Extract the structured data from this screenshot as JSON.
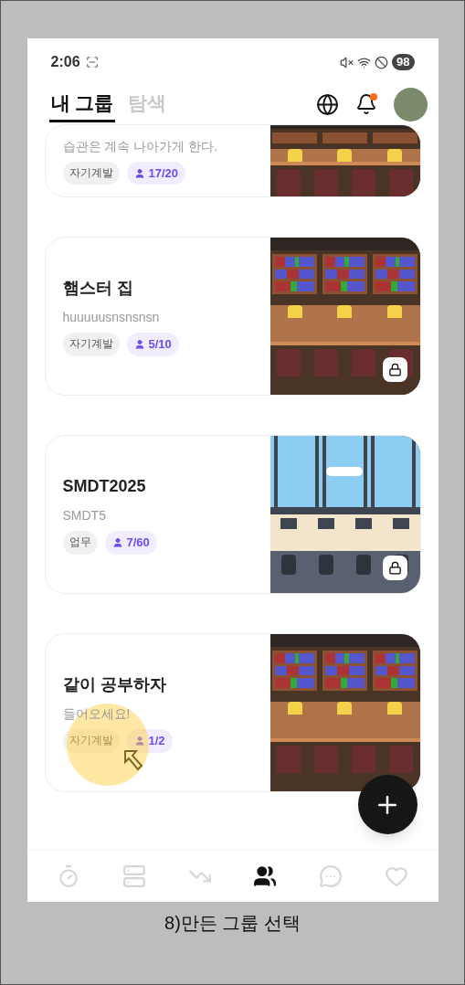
{
  "status_bar": {
    "time": "2:06",
    "battery": "98"
  },
  "header": {
    "tabs": [
      {
        "label": "내 그룹",
        "selected": true
      },
      {
        "label": "탐색",
        "selected": false
      }
    ],
    "has_notification": true
  },
  "groups": [
    {
      "description": "습관은 계속 나아가게 한다.",
      "category": "자기계발",
      "members": "17/20",
      "locked": false,
      "kind": "library"
    },
    {
      "title": "햄스터 집",
      "description": "huuuuusnsnsnsn",
      "category": "자기계발",
      "members": "5/10",
      "locked": true,
      "kind": "library"
    },
    {
      "title": "SMDT2025",
      "description": "SMDT5",
      "category": "업무",
      "members": "7/60",
      "locked": true,
      "kind": "office"
    },
    {
      "title": "같이 공부하자",
      "description": "들어오세요!",
      "category": "자기계발",
      "members": "1/2",
      "locked": false,
      "kind": "library"
    }
  ],
  "nav": [
    {
      "selected": false
    },
    {
      "selected": false
    },
    {
      "selected": false
    },
    {
      "selected": true
    },
    {
      "selected": false
    },
    {
      "selected": false
    }
  ],
  "caption": "8)만든 그룹 선택"
}
